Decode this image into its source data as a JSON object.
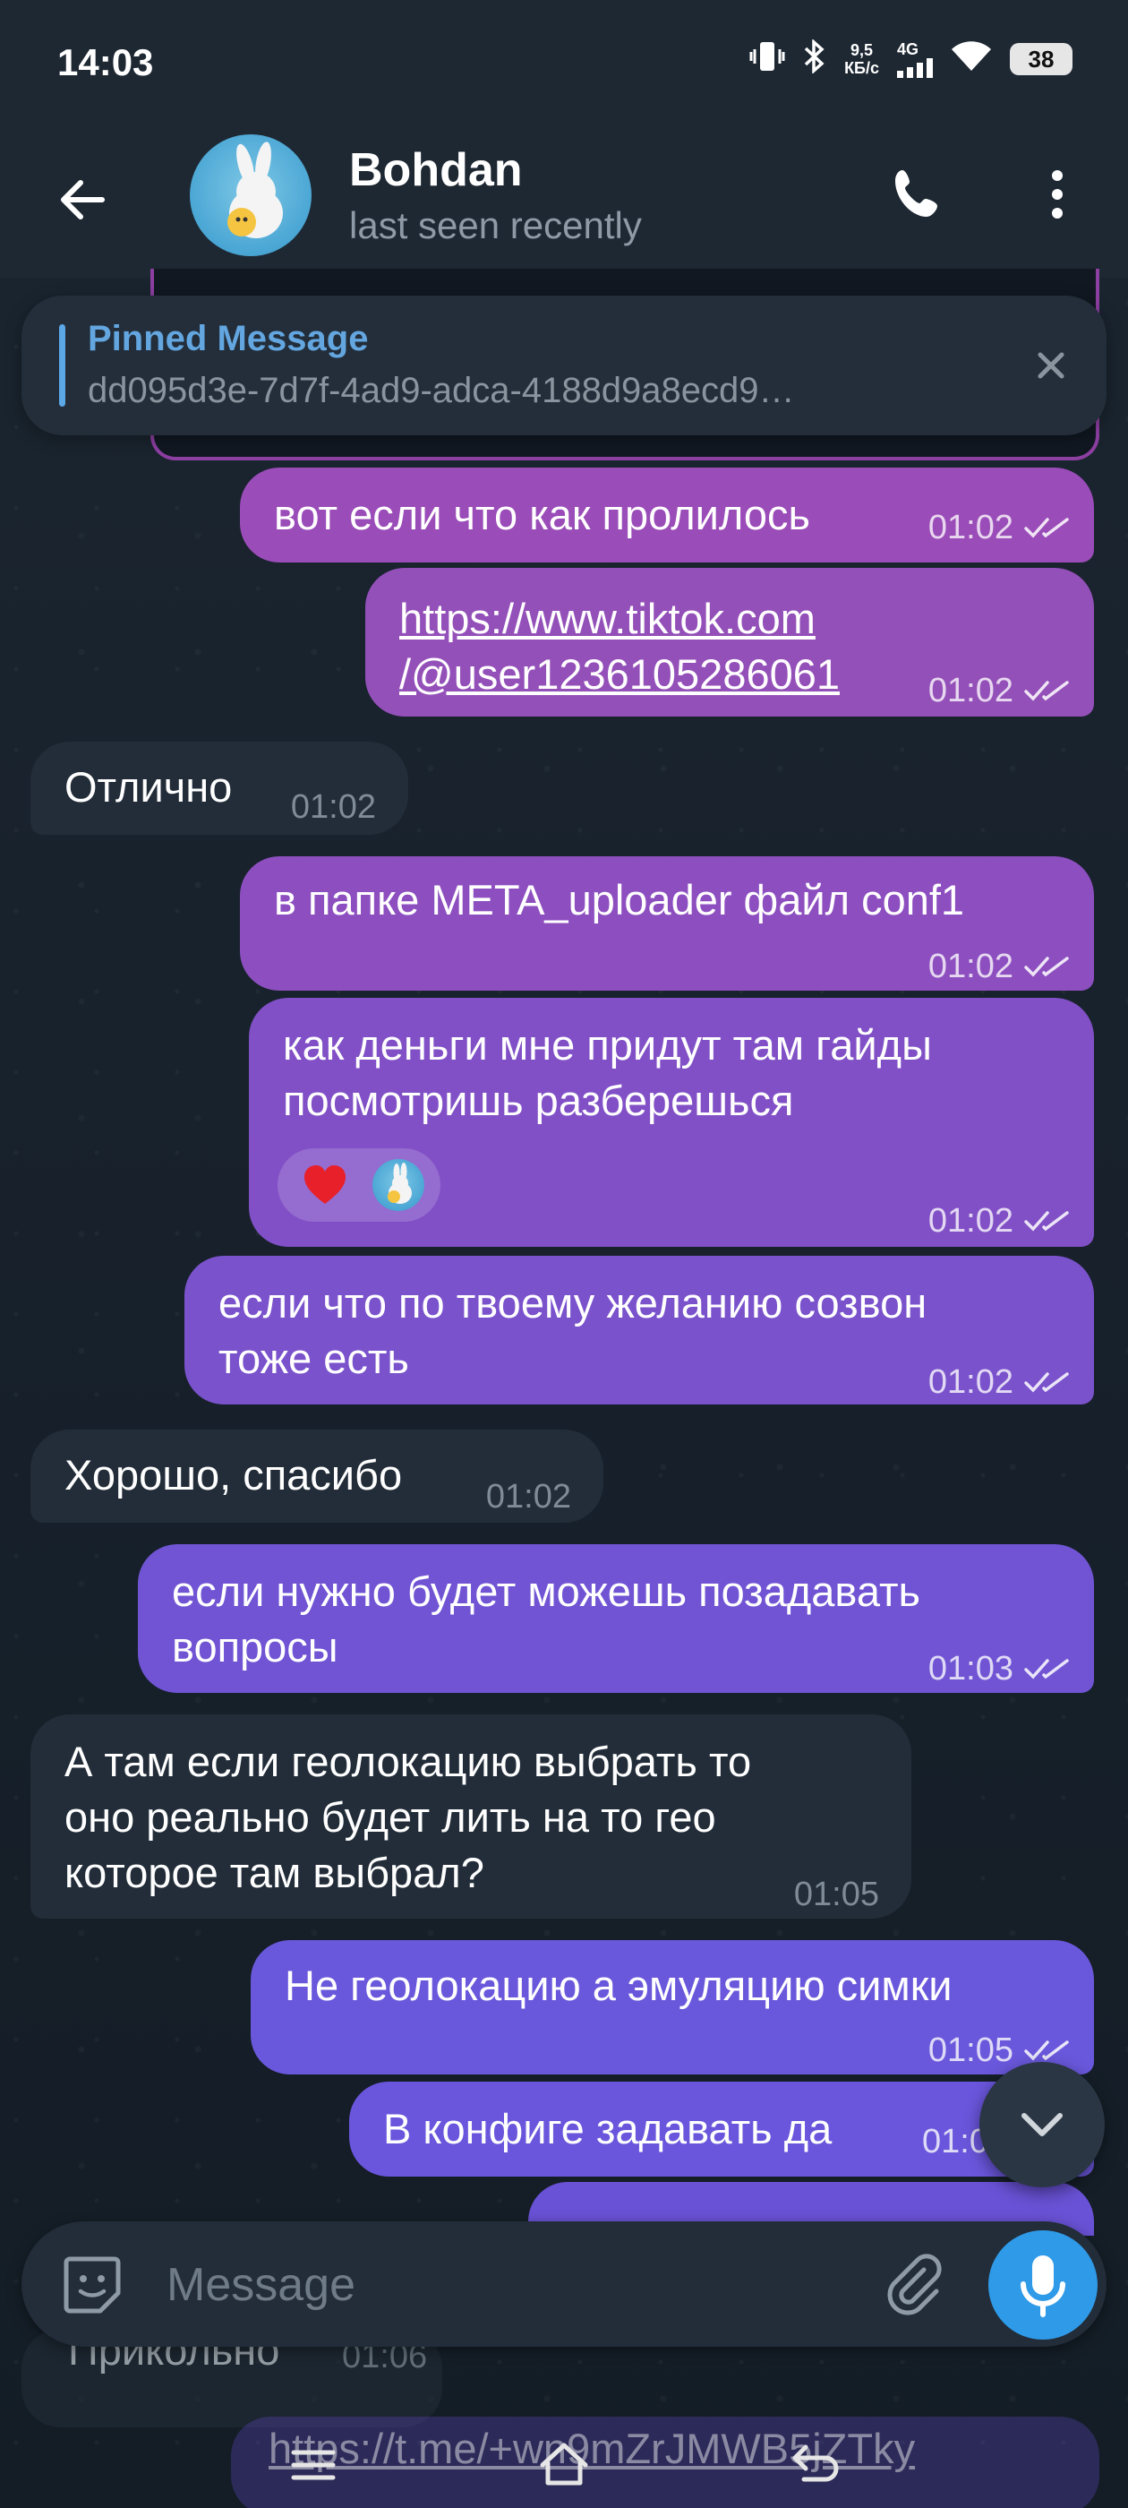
{
  "status_bar": {
    "time": "14:03",
    "net_speed_value": "9,5",
    "net_speed_unit": "КБ/с",
    "network_type": "4G",
    "battery": "38"
  },
  "header": {
    "name": "Bohdan",
    "status": "last seen recently"
  },
  "pinned": {
    "title": "Pinned Message",
    "text": "dd095d3e-7d7f-4ad9-adca-4188d9a8ecd9…"
  },
  "messages": [
    {
      "text": "вот если что как пролилось",
      "time": "01:02",
      "direction": "out"
    },
    {
      "line1": "https://www.tiktok.com",
      "line2": "/@user1236105286061",
      "time": "01:02",
      "direction": "out"
    },
    {
      "text": "Отлично",
      "time": "01:02",
      "direction": "in"
    },
    {
      "text": "в папке META_uploader файл conf1",
      "time": "01:02",
      "direction": "out"
    },
    {
      "line1": "как деньги мне придут там гайды",
      "line2": "посмотришь разберешься",
      "time": "01:02",
      "direction": "out",
      "reactions": [
        "heart",
        "avatar"
      ]
    },
    {
      "line1": "если что по твоему желанию созвон",
      "line2": "тоже есть",
      "time": "01:02",
      "direction": "out"
    },
    {
      "text": "Хорошо, спасибо",
      "time": "01:02",
      "direction": "in"
    },
    {
      "line1": "если нужно будет можешь позадавать",
      "line2": "вопросы",
      "time": "01:03",
      "direction": "out"
    },
    {
      "line1": "А там если геолокацию выбрать то",
      "line2": "оно реально будет лить на то гео",
      "line3": "которое там выбрал?",
      "time": "01:05",
      "direction": "in"
    },
    {
      "text": "Не геолокацию а эмуляцию симки",
      "time": "01:05",
      "direction": "out"
    },
    {
      "text": "В конфиге задавать да",
      "time": "01:0",
      "direction": "out"
    }
  ],
  "peek": {
    "incoming_text": "Прикольно",
    "incoming_time": "01:06",
    "link_text": "https://t.me/+wn9mZrJMWB5jZTky"
  },
  "composer": {
    "placeholder": "Message"
  },
  "colors": {
    "outgoing_top": "#9b4bb8",
    "outgoing_bottom": "#6a5cdf",
    "incoming": "#222d39",
    "accent": "#2f9ae8"
  },
  "icons": {
    "back": "arrow-left-icon",
    "call": "phone-icon",
    "menu": "more-vertical-icon",
    "close": "close-icon",
    "emoji": "sticker-icon",
    "attach": "paperclip-icon",
    "mic": "microphone-icon",
    "scroll": "chevron-down-icon",
    "read": "double-check-icon"
  }
}
